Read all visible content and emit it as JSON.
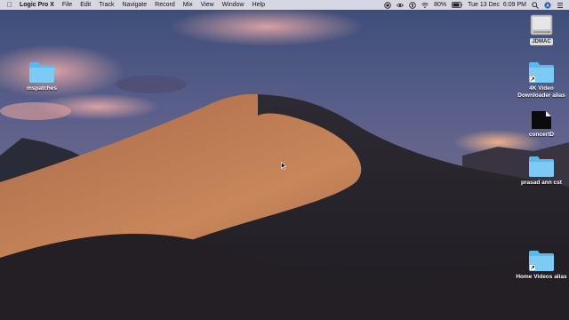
{
  "menubar": {
    "app_name": "Logic Pro X",
    "menus": [
      "File",
      "Edit",
      "Track",
      "Navigate",
      "Record",
      "Mix",
      "View",
      "Window",
      "Help"
    ],
    "battery": "80%",
    "clock": "Tue 13 Dec  6:09 PM",
    "icons": [
      "apple-icon",
      "record-icon",
      "eye-icon",
      "notification-icon",
      "wifi-icon",
      "battery-icon",
      "search-icon",
      "user-icon",
      "menu-list-icon"
    ]
  },
  "desktop_icons": {
    "disk": {
      "label": "JDMAC",
      "icon": "hard-disk-icon"
    },
    "mspatches": {
      "label": "mspatches",
      "icon": "folder-icon"
    },
    "video_downloader": {
      "label": "4K Video Downloader alias",
      "icon": "folder-alias-icon"
    },
    "concert": {
      "label": "concertD",
      "icon": "document-icon"
    },
    "prasad": {
      "label": "prasad ann cst",
      "icon": "folder-icon"
    },
    "home_videos": {
      "label": "Home Videos alias",
      "icon": "folder-alias-icon"
    }
  },
  "colors": {
    "menubar": "#ebebf0",
    "folder": "#6fc3f2",
    "sky_top": "#3b4c78",
    "dune_light": "#c27a52",
    "dune_shadow": "#2a2529"
  }
}
